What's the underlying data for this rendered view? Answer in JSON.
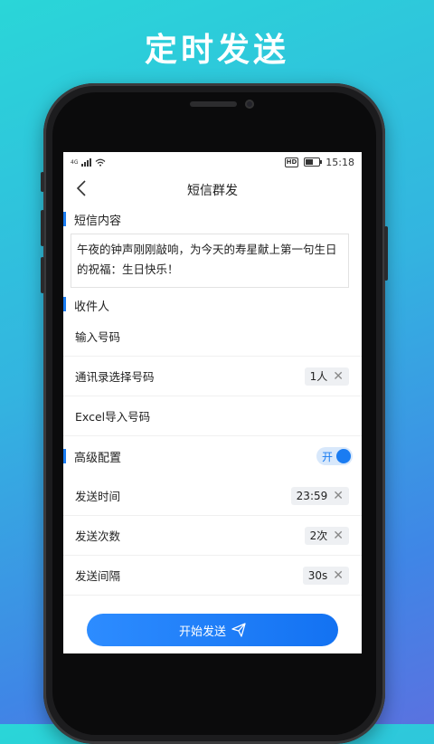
{
  "headline": "定时发送",
  "status_bar": {
    "network": "4G",
    "hd_badge": "HD",
    "time": "15:18"
  },
  "nav": {
    "back_icon": "chevron-left-icon",
    "title": "短信群发"
  },
  "sms_content": {
    "section_title": "短信内容",
    "message": "午夜的钟声刚刚敲响，为今天的寿星献上第一句生日的祝福：生日快乐！"
  },
  "recipients": {
    "section_title": "收件人",
    "input_label": "输入号码",
    "contacts_label": "通讯录选择号码",
    "contacts_value": "1人",
    "excel_label": "Excel导入号码"
  },
  "advanced": {
    "section_title": "高级配置",
    "toggle_label": "开",
    "toggle_on": true,
    "send_time_label": "发送时间",
    "send_time_value": "23:59",
    "send_count_label": "发送次数",
    "send_count_value": "2次",
    "interval_label": "发送间隔",
    "interval_value": "30s"
  },
  "start_button": {
    "label": "开始发送",
    "icon": "paper-plane-icon"
  },
  "colors": {
    "accent": "#1a7cf2",
    "background_top": "#2ad6d8",
    "background_bottom": "#5a72e0"
  }
}
